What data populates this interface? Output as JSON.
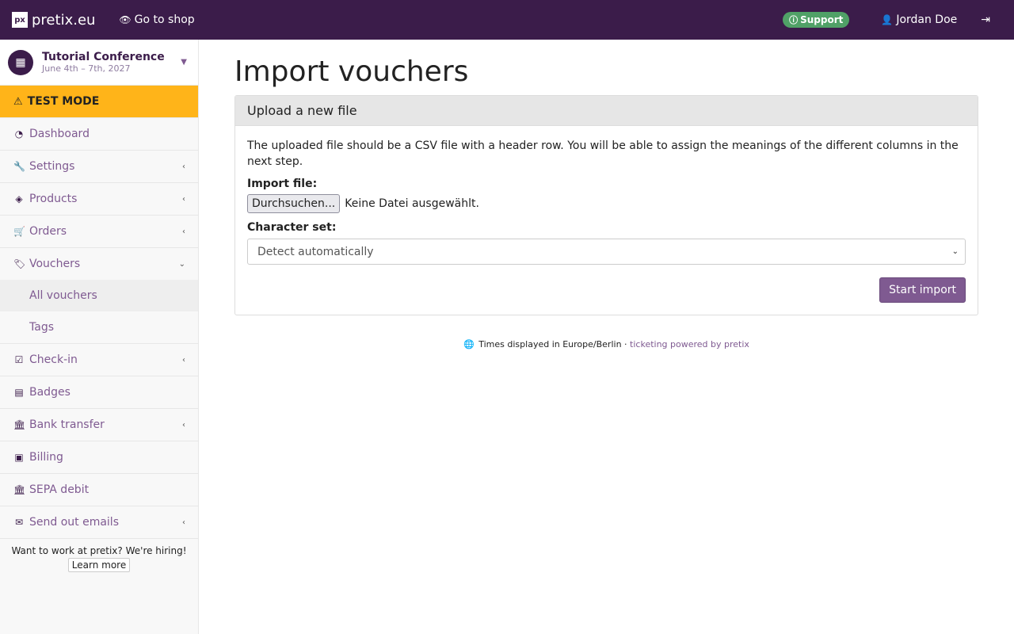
{
  "topbar": {
    "brand_logo": "px",
    "brand_name": "pretix.eu",
    "goto_shop": "Go to shop",
    "support": "Support",
    "user_name": "Jordan Doe"
  },
  "sidebar": {
    "event_title": "Tutorial Conference",
    "event_date": "June 4th – 7th, 2027",
    "test_mode": "TEST MODE",
    "items": [
      {
        "label": "Dashboard"
      },
      {
        "label": "Settings"
      },
      {
        "label": "Products"
      },
      {
        "label": "Orders"
      },
      {
        "label": "Vouchers"
      },
      {
        "label": "Check-in"
      },
      {
        "label": "Badges"
      },
      {
        "label": "Bank transfer"
      },
      {
        "label": "Billing"
      },
      {
        "label": "SEPA debit"
      },
      {
        "label": "Send out emails"
      }
    ],
    "vouchers_sub": [
      {
        "label": "All vouchers"
      },
      {
        "label": "Tags"
      }
    ],
    "hiring_text": "Want to work at pretix? We're hiring!",
    "hiring_button": "Learn more"
  },
  "main": {
    "title": "Import vouchers",
    "panel_heading": "Upload a new file",
    "help_text": "The uploaded file should be a CSV file with a header row. You will be able to assign the meanings of the different columns in the next step.",
    "file_label": "Import file:",
    "file_button": "Durchsuchen...",
    "file_status": "Keine Datei ausgewählt.",
    "charset_label": "Character set:",
    "charset_value": "Detect automatically",
    "submit": "Start import"
  },
  "footer": {
    "timezone": "Times displayed in Europe/Berlin",
    "separator": "·",
    "powered": "ticketing powered by pretix"
  },
  "colors": {
    "brand": "#3b1c4a",
    "accent": "#7f5a91",
    "test_mode": "#ffb419",
    "support": "#50a167"
  }
}
